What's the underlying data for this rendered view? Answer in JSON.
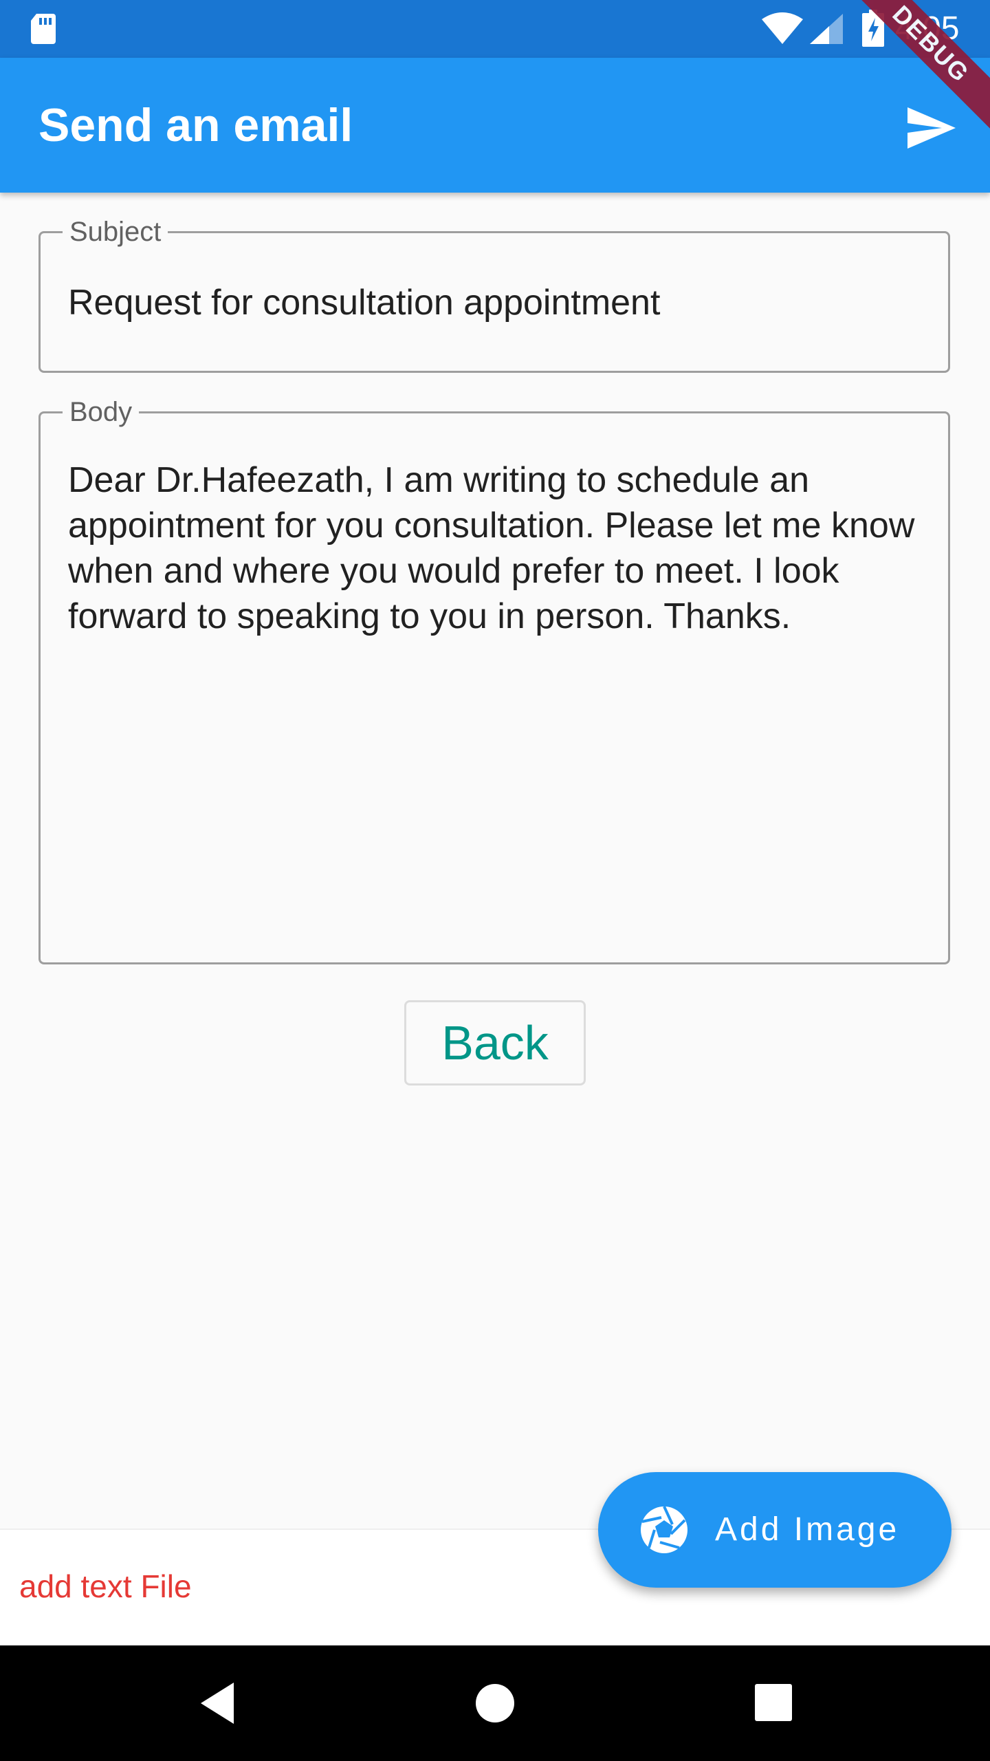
{
  "status_bar": {
    "time": "4:05",
    "icons": [
      "sd-card-icon",
      "wifi-icon",
      "cell-signal-icon",
      "battery-charging-icon"
    ]
  },
  "app_bar": {
    "title": "Send an email",
    "action_icon": "send-icon"
  },
  "debug_banner": "DEBUG",
  "form": {
    "subject": {
      "label": "Subject",
      "value": "Request for consultation appointment"
    },
    "body": {
      "label": "Body",
      "value": "Dear Dr.Hafeezath, I am writing to schedule an appointment for you consultation. Please let me know when and where you would prefer to meet. I look forward to speaking to you in person. Thanks."
    }
  },
  "back_button": "Back",
  "fab": {
    "label": "Add Image",
    "icon": "camera-shutter-icon"
  },
  "bottom_bar": {
    "link": "add text File"
  },
  "nav_bar": {
    "icons": [
      "nav-back-icon",
      "nav-home-icon",
      "nav-recents-icon"
    ]
  },
  "colors": {
    "status_bar": "#1976d2",
    "app_bar": "#2196f3",
    "back_text": "#009688",
    "link_text": "#e53935",
    "debug_banner": "#8e1b3a"
  }
}
